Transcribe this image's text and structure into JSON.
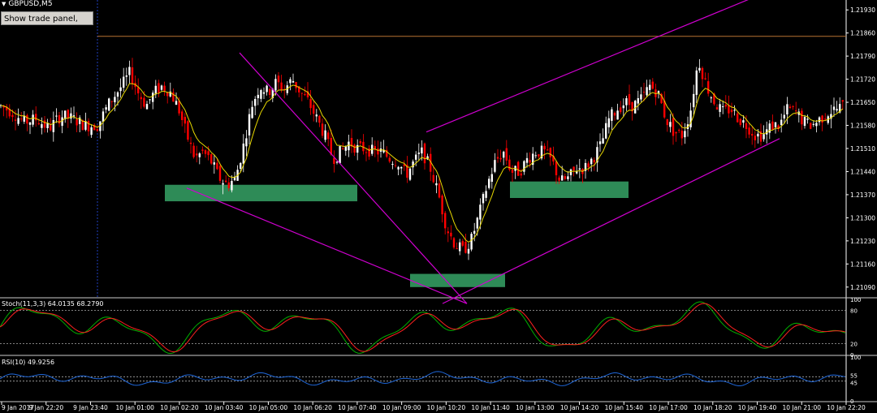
{
  "window": {
    "symbol": "GBPUSD,M5",
    "menu_icon": "down-triangle-icon"
  },
  "trade_panel": {
    "label": "Show trade panel, Alt+T"
  },
  "colors": {
    "background": "#000000",
    "bull": "#ffffff",
    "bear": "#ff0000",
    "ma": "#e8d800",
    "channel": "#d000d0",
    "zone": "#2e8b57",
    "hline": "#b87333",
    "stoch_main": "#00b000",
    "stoch_signal": "#ff2020",
    "rsi": "#1e66d8",
    "axis": "#ffffff"
  },
  "chart_data": [
    {
      "type": "candlestick",
      "panel": "price",
      "y_ticks": [
        "1.21930",
        "1.21860",
        "1.21790",
        "1.21720",
        "1.21650",
        "1.21580",
        "1.21510",
        "1.21440",
        "1.21370",
        "1.21300",
        "1.21230",
        "1.21160",
        "1.21090"
      ],
      "ylim": [
        1.2106,
        1.2196
      ],
      "horizontal_line": 1.2185,
      "x_ticks": [
        "9 Jan 2017",
        "9 Jan 22:20",
        "9 Jan 23:40",
        "10 Jan 01:00",
        "10 Jan 02:20",
        "10 Jan 03:40",
        "10 Jan 05:00",
        "10 Jan 06:20",
        "10 Jan 07:40",
        "10 Jan 09:00",
        "10 Jan 10:20",
        "10 Jan 11:40",
        "10 Jan 13:00",
        "10 Jan 14:20",
        "10 Jan 15:40",
        "10 Jan 17:00",
        "10 Jan 18:20",
        "10 Jan 19:40",
        "10 Jan 21:00",
        "10 Jan 22:20"
      ],
      "close_path": [
        [
          0,
          1.2164
        ],
        [
          15,
          1.2162
        ],
        [
          30,
          1.2159
        ],
        [
          45,
          1.216
        ],
        [
          60,
          1.2157
        ],
        [
          75,
          1.2161
        ],
        [
          90,
          1.216
        ],
        [
          105,
          1.2158
        ],
        [
          120,
          1.2158
        ],
        [
          135,
          1.2165
        ],
        [
          150,
          1.217
        ],
        [
          160,
          1.2174
        ],
        [
          170,
          1.2168
        ],
        [
          180,
          1.2164
        ],
        [
          190,
          1.2168
        ],
        [
          200,
          1.217
        ],
        [
          210,
          1.2168
        ],
        [
          220,
          1.2163
        ],
        [
          230,
          1.2155
        ],
        [
          240,
          1.2148
        ],
        [
          250,
          1.215
        ],
        [
          260,
          1.2147
        ],
        [
          270,
          1.2142
        ],
        [
          280,
          1.214
        ],
        [
          290,
          1.2142
        ],
        [
          300,
          1.2152
        ],
        [
          310,
          1.2164
        ],
        [
          320,
          1.217
        ],
        [
          330,
          1.2168
        ],
        [
          340,
          1.2171
        ],
        [
          350,
          1.2169
        ],
        [
          360,
          1.2172
        ],
        [
          370,
          1.2168
        ],
        [
          380,
          1.2165
        ],
        [
          390,
          1.216
        ],
        [
          400,
          1.2155
        ],
        [
          410,
          1.2148
        ],
        [
          420,
          1.215
        ],
        [
          430,
          1.2153
        ],
        [
          440,
          1.2151
        ],
        [
          450,
          1.2151
        ],
        [
          460,
          1.215
        ],
        [
          470,
          1.215
        ],
        [
          480,
          1.2148
        ],
        [
          490,
          1.2147
        ],
        [
          500,
          1.2143
        ],
        [
          510,
          1.2147
        ],
        [
          520,
          1.215
        ],
        [
          530,
          1.2145
        ],
        [
          540,
          1.2137
        ],
        [
          550,
          1.2127
        ],
        [
          560,
          1.2122
        ],
        [
          570,
          1.212
        ],
        [
          580,
          1.2123
        ],
        [
          590,
          1.2131
        ],
        [
          600,
          1.214
        ],
        [
          610,
          1.2147
        ],
        [
          620,
          1.215
        ],
        [
          630,
          1.2144
        ],
        [
          640,
          1.2144
        ],
        [
          650,
          1.2148
        ],
        [
          660,
          1.215
        ],
        [
          670,
          1.215
        ],
        [
          680,
          1.2147
        ],
        [
          690,
          1.2141
        ],
        [
          700,
          1.2142
        ],
        [
          710,
          1.2145
        ],
        [
          720,
          1.2145
        ],
        [
          730,
          1.2148
        ],
        [
          740,
          1.2152
        ],
        [
          750,
          1.216
        ],
        [
          760,
          1.2163
        ],
        [
          770,
          1.2165
        ],
        [
          780,
          1.2164
        ],
        [
          790,
          1.2166
        ],
        [
          800,
          1.217
        ],
        [
          810,
          1.2168
        ],
        [
          820,
          1.216
        ],
        [
          830,
          1.2156
        ],
        [
          840,
          1.2155
        ],
        [
          850,
          1.2162
        ],
        [
          860,
          1.2178
        ],
        [
          870,
          1.217
        ],
        [
          880,
          1.2165
        ],
        [
          890,
          1.2162
        ],
        [
          900,
          1.2163
        ],
        [
          910,
          1.216
        ],
        [
          920,
          1.2158
        ],
        [
          930,
          1.2155
        ],
        [
          940,
          1.2155
        ],
        [
          950,
          1.2158
        ],
        [
          960,
          1.2158
        ],
        [
          970,
          1.2163
        ],
        [
          980,
          1.2162
        ],
        [
          990,
          1.2159
        ],
        [
          1000,
          1.2158
        ],
        [
          1010,
          1.216
        ],
        [
          1020,
          1.2162
        ],
        [
          1030,
          1.2163
        ],
        [
          1040,
          1.2164
        ]
      ],
      "channel_lines": [
        [
          [
            295,
            1.218
          ],
          [
            575,
            1.2104
          ]
        ],
        [
          [
            230,
            1.2139
          ],
          [
            575,
            1.2104
          ]
        ],
        [
          [
            525,
            1.2156
          ],
          [
            940,
            1.2198
          ]
        ],
        [
          [
            545,
            1.2104
          ],
          [
            960,
            1.2154
          ]
        ]
      ],
      "zones": [
        {
          "x": [
            203,
            440
          ],
          "y": [
            1.2135,
            1.214
          ]
        },
        {
          "x": [
            505,
            622
          ],
          "y": [
            1.2109,
            1.2113
          ]
        },
        {
          "x": [
            628,
            774
          ],
          "y": [
            1.2136,
            1.2141
          ]
        }
      ]
    },
    {
      "type": "line",
      "panel": "oscillator",
      "label": "Stoch(11,3,3) 64.0135 68.2790",
      "y_ticks": [
        "100",
        "80",
        "20",
        "0"
      ],
      "ylim": [
        0,
        100
      ],
      "levels": [
        20,
        80
      ],
      "series": [
        {
          "name": "main",
          "color": "#00b000"
        },
        {
          "name": "signal",
          "color": "#ff2020"
        }
      ]
    },
    {
      "type": "line",
      "panel": "oscillator",
      "label": "RSI(10) 49.9256",
      "y_ticks": [
        "100",
        "55",
        "45",
        "0"
      ],
      "ylim": [
        0,
        100
      ],
      "levels": [
        55,
        45
      ],
      "series": [
        {
          "name": "rsi",
          "color": "#1e66d8"
        }
      ]
    }
  ]
}
